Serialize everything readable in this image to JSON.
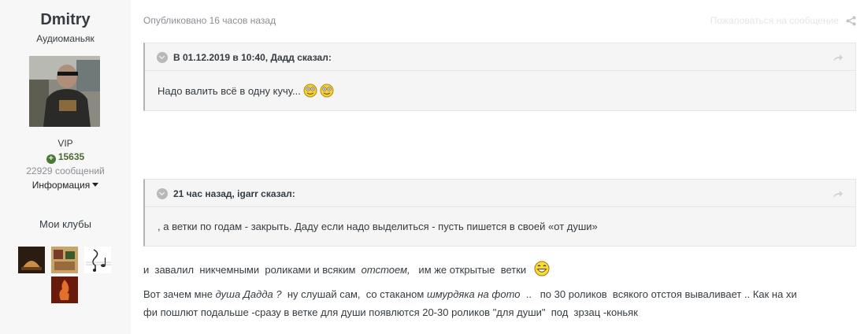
{
  "author": {
    "name": "Dmitry",
    "title": "Аудиоманьяк",
    "group": "VIP",
    "reputation": "15635",
    "posts": "22929 сообщений",
    "info_label": "Информация"
  },
  "clubs": {
    "title": "Мои клубы"
  },
  "post": {
    "date": "Опубликовано 16 часов назад",
    "report": "Пожаловаться на сообщение",
    "quotes": [
      {
        "cite": "В 01.12.2019 в 10:40, Дадд сказал:",
        "body": "Надо валить всё в одну кучу..."
      },
      {
        "cite": "21 час назад, igarr сказал:",
        "body": ", а ветки по годам - закрыть. Даду если надо выделиться - пусть пишется в своей «от души»"
      }
    ],
    "line1": {
      "a": "и  завалил  никчемными  роликами и всяким  ",
      "b": "отстоем,",
      "c": "   им же открытые  ветки  "
    },
    "line2": {
      "a": "Вот зачем мне ",
      "b": "душа Дадда ?",
      "c": "  ну слушай сам,  со стаканом ",
      "d": "шмурдяка на фото",
      "e": "  ..   по 30 роликов  всякого отстоя вываливает .. Как на хи"
    },
    "line3": "фи пошлют подальше -сразу в ветке для души появлются 20-30 роликов \"для души\"  под  зрзац -коньяк"
  },
  "icons": {
    "share": "share-icon",
    "quote_link": "link-arrow-icon",
    "toggle": "chevron-down-icon",
    "rep": "plus-circle-icon",
    "emoji": "smiley-icon"
  }
}
